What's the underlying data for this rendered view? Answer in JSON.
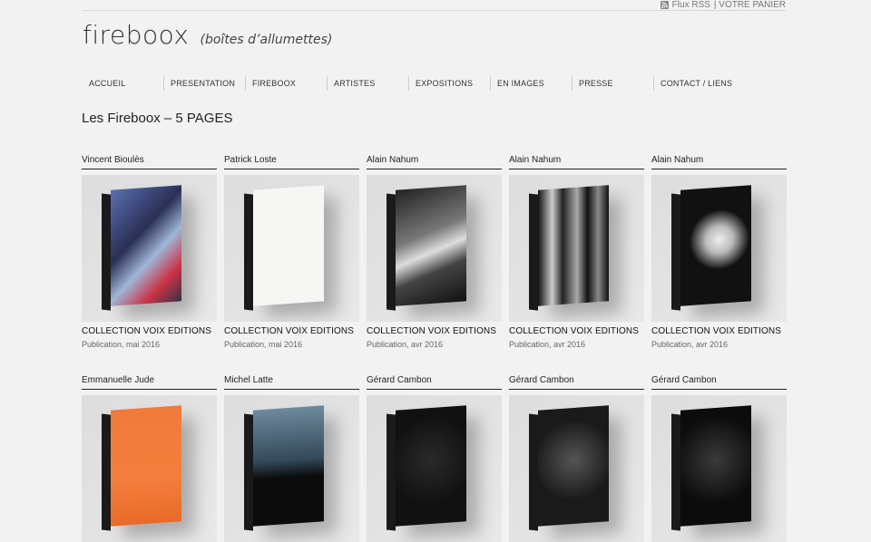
{
  "header": {
    "rss_label": "Flux RSS",
    "cart_label": "| VOTRE PANIER",
    "logo": "fireboox",
    "tagline": "(boîtes d’allumettes)"
  },
  "nav": [
    "ACCUEIL",
    "PRESENTATION",
    "FIREBOOX",
    "ARTISTES",
    "EXPOSITIONS",
    "EN IMAGES",
    "PRESSE",
    "CONTACT / LIENS"
  ],
  "page_title": "Les Fireboox – 5 PAGES",
  "cards": [
    {
      "artist": "Vincent Bioulès",
      "title": "COLLECTION VOIX EDITIONS",
      "date": "Publication, mai 2016"
    },
    {
      "artist": "Patrick Loste",
      "title": "COLLECTION VOIX EDITIONS",
      "date": "Publication, mai 2016"
    },
    {
      "artist": "Alain Nahum",
      "title": "COLLECTION VOIX EDITIONS",
      "date": "Publication, avr 2016"
    },
    {
      "artist": "Alain Nahum",
      "title": "COLLECTION VOIX EDITIONS",
      "date": "Publication, avr 2016"
    },
    {
      "artist": "Alain Nahum",
      "title": "COLLECTION VOIX EDITIONS",
      "date": "Publication, avr 2016"
    },
    {
      "artist": "Emmanuelle Jude",
      "title": "",
      "date": ""
    },
    {
      "artist": "Michel Latte",
      "title": "",
      "date": ""
    },
    {
      "artist": "Gérard Cambon",
      "title": "",
      "date": ""
    },
    {
      "artist": "Gérard Cambon",
      "title": "",
      "date": ""
    },
    {
      "artist": "Gérard Cambon",
      "title": "",
      "date": ""
    }
  ],
  "colors": {
    "background": "#f2f2f2",
    "text": "#222222",
    "muted": "#666666",
    "rss_orange": "#e07a1f"
  },
  "icons": {
    "rss": "rss-feed-icon"
  }
}
